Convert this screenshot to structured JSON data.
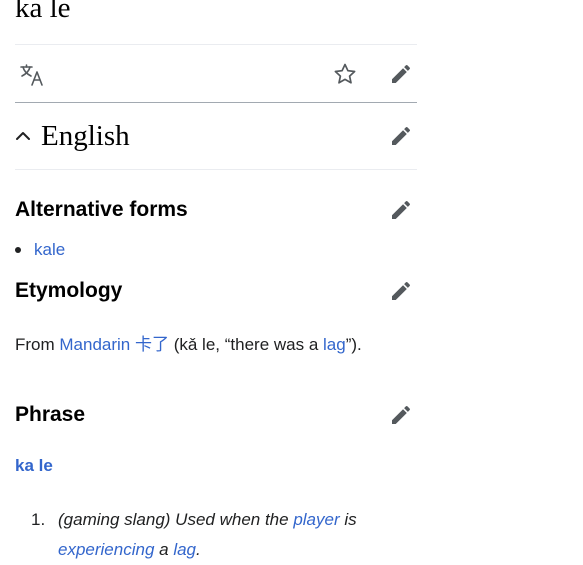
{
  "page": {
    "title": "ka le"
  },
  "toolbar": {
    "translate_icon": "translate-icon",
    "watch_icon": "star-icon",
    "edit_icon": "pencil-icon"
  },
  "language_section": {
    "label": "English",
    "collapse_icon": "chevron-up-icon"
  },
  "alternative_forms": {
    "heading": "Alternative forms",
    "items": [
      "kale"
    ]
  },
  "etymology": {
    "heading": "Etymology",
    "text_from": "From ",
    "link_mandarin": "Mandarin",
    "space1": " ",
    "link_chinese": "卡了",
    "text_mid": " (kǎ le, “there was a ",
    "link_lag": "lag",
    "text_end": "”)."
  },
  "phrase": {
    "heading": "Phrase",
    "headword": "ka le",
    "definitions": [
      {
        "number": "1.",
        "qualifier": "(gaming slang)",
        "text1": " Used when the ",
        "link_player": "player",
        "text2": " is ",
        "link_experiencing": "experiencing",
        "text3": " a ",
        "link_lag": "lag",
        "text4": "."
      }
    ]
  },
  "colors": {
    "link": "#3366cc",
    "text": "#202122",
    "divider": "#eaecf0",
    "icon": "#54595d"
  }
}
